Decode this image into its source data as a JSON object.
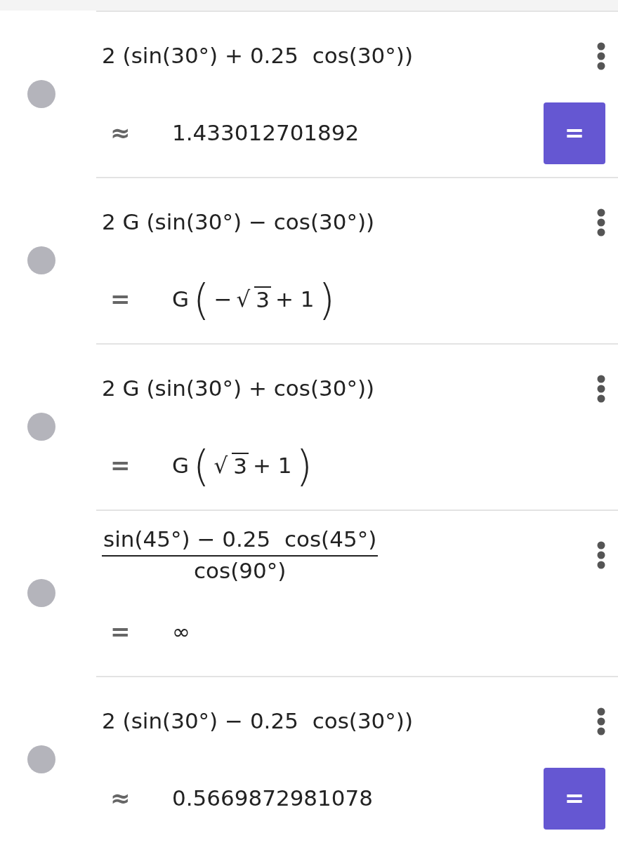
{
  "items": [
    {
      "input": {
        "kind": "text",
        "text": "2 (sin(30°) + 0.25  cos(30°))"
      },
      "output": {
        "sign": "≈",
        "kind": "text",
        "text": "1.433012701892"
      },
      "toggle": {
        "label": "="
      }
    },
    {
      "input": {
        "kind": "text",
        "text": "2 G (sin(30°) − cos(30°))"
      },
      "output": {
        "sign": "=",
        "kind": "factored",
        "coef": "G",
        "open": "(",
        "lead": "−",
        "root": "√",
        "radicand": "3",
        "close": ")",
        "tail": "+ 1"
      }
    },
    {
      "input": {
        "kind": "text",
        "text": "2 G (sin(30°) + cos(30°))"
      },
      "output": {
        "sign": "=",
        "kind": "factored",
        "coef": "G",
        "open": "(",
        "root": "√",
        "radicand": "3",
        "close": ")",
        "tail": "+ 1"
      }
    },
    {
      "input": {
        "kind": "fraction",
        "numerator": "sin(45°) − 0.25  cos(45°)",
        "denominator": "cos(90°)"
      },
      "output": {
        "sign": "=",
        "kind": "text",
        "text": "∞"
      }
    },
    {
      "input": {
        "kind": "text",
        "text": "2 (sin(30°) − 0.25  cos(30°))"
      },
      "output": {
        "sign": "≈",
        "kind": "text",
        "text": "0.5669872981078"
      },
      "toggle": {
        "label": "="
      }
    }
  ]
}
